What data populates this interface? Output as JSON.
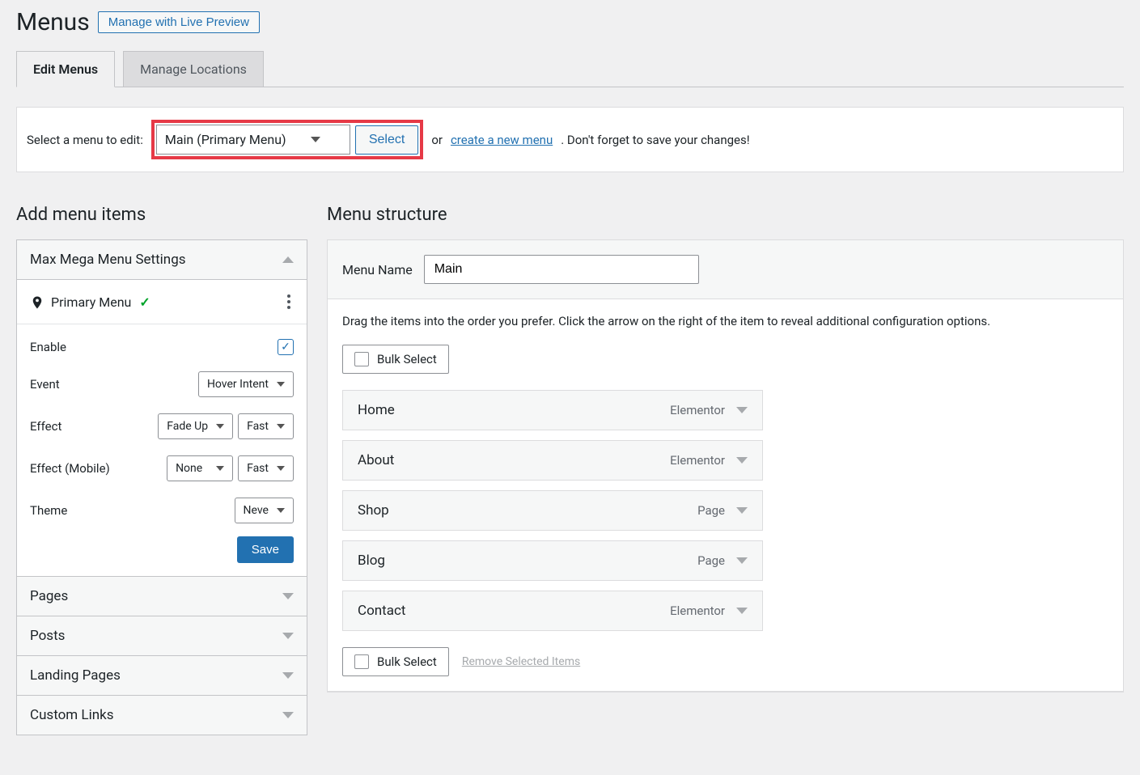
{
  "header": {
    "title": "Menus",
    "live_preview_btn": "Manage with Live Preview"
  },
  "tabs": {
    "edit": "Edit Menus",
    "locations": "Manage Locations"
  },
  "select_bar": {
    "label": "Select a menu to edit:",
    "selected": "Main (Primary Menu)",
    "select_btn": "Select",
    "or": " or ",
    "create_link": "create a new menu",
    "suffix": ". Don't forget to save your changes!"
  },
  "add_items": {
    "title": "Add menu items",
    "mm_settings": {
      "header": "Max Mega Menu Settings",
      "location": "Primary Menu",
      "rows": {
        "enable": "Enable",
        "event_label": "Event",
        "event_value": "Hover Intent",
        "effect_label": "Effect",
        "effect_value": "Fade Up",
        "effect_speed": "Fast",
        "effect_mobile_label": "Effect (Mobile)",
        "effect_mobile_value": "None",
        "effect_mobile_speed": "Fast",
        "theme_label": "Theme",
        "theme_value": "Neve"
      },
      "save_btn": "Save"
    },
    "panels": {
      "pages": "Pages",
      "posts": "Posts",
      "landing": "Landing Pages",
      "custom": "Custom Links"
    }
  },
  "structure": {
    "title": "Menu structure",
    "name_label": "Menu Name",
    "name_value": "Main",
    "help": "Drag the items into the order you prefer. Click the arrow on the right of the item to reveal additional configuration options.",
    "bulk_select": "Bulk Select",
    "remove_selected": "Remove Selected Items",
    "items": [
      {
        "title": "Home",
        "type": "Elementor"
      },
      {
        "title": "About",
        "type": "Elementor"
      },
      {
        "title": "Shop",
        "type": "Page"
      },
      {
        "title": "Blog",
        "type": "Page"
      },
      {
        "title": "Contact",
        "type": "Elementor"
      }
    ]
  }
}
